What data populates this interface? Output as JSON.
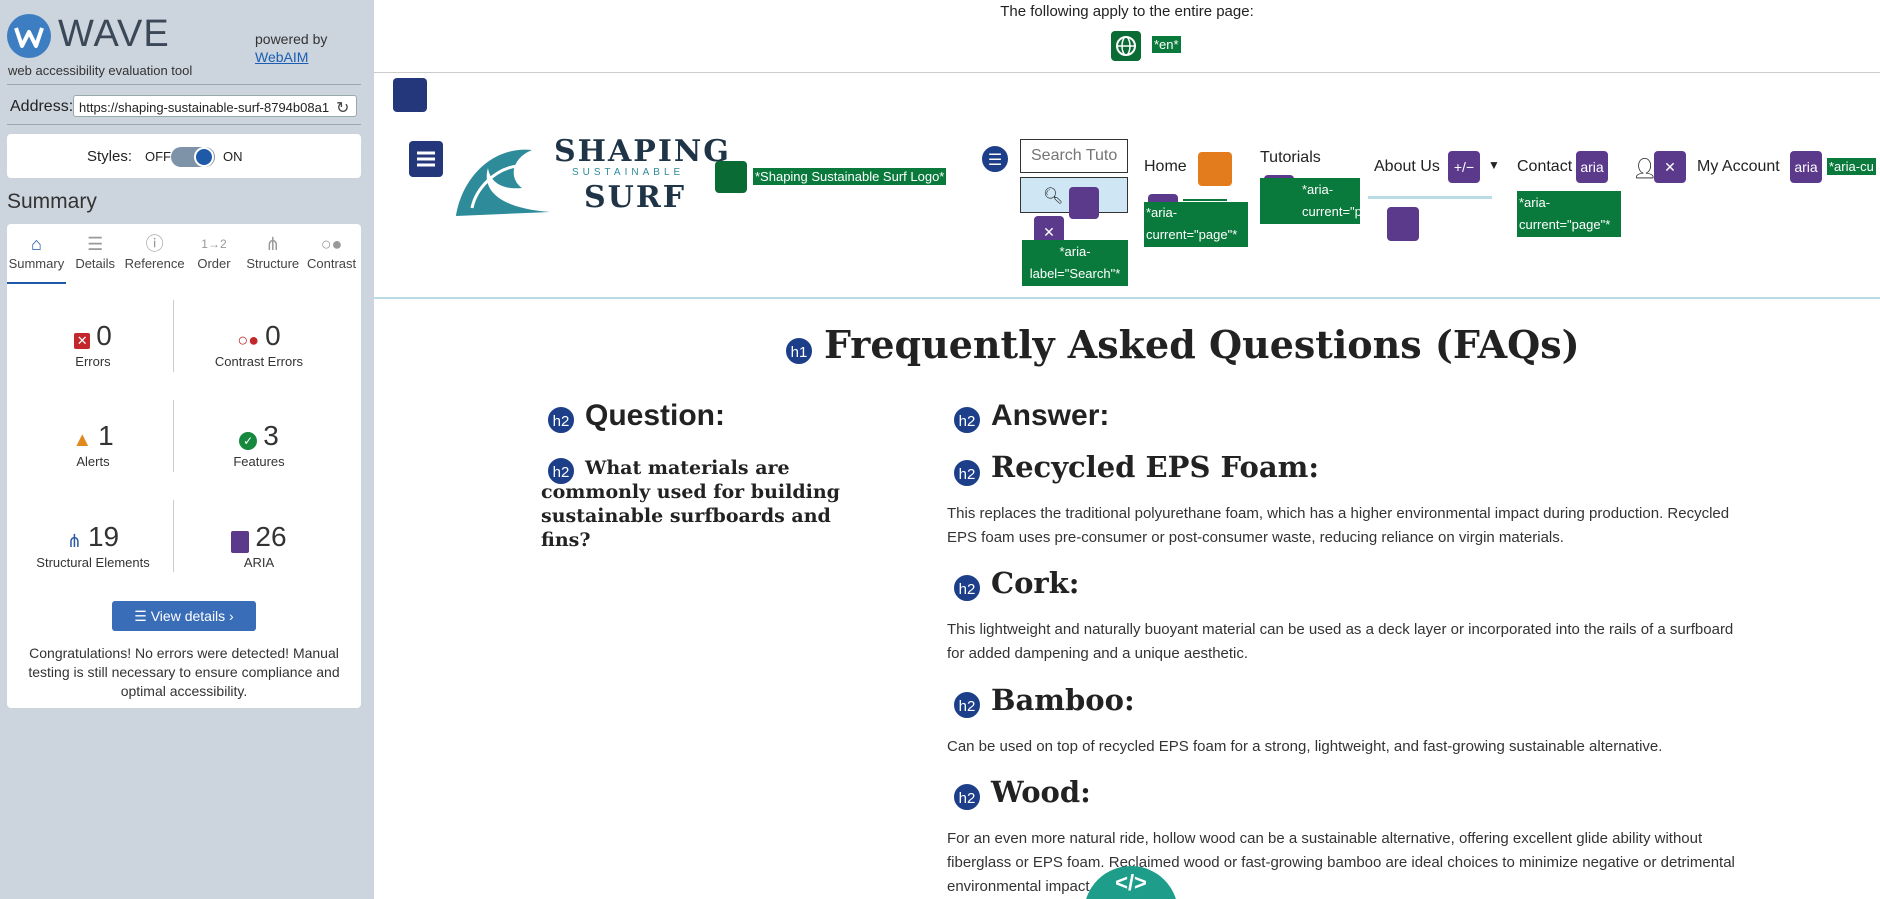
{
  "wave": {
    "logo_text": "WAVE",
    "subtitle": "web accessibility evaluation tool",
    "powered_by": "powered by",
    "webaim_link": "WebAIM",
    "address_label": "Address:",
    "address_value": "https://shaping-sustainable-surf-8794b08a1",
    "styles_label": "Styles:",
    "styles_off": "OFF",
    "styles_on": "ON",
    "summary_title": "Summary",
    "tabs": [
      {
        "label": "Summary",
        "icon": "home-icon"
      },
      {
        "label": "Details",
        "icon": "list-icon"
      },
      {
        "label": "Reference",
        "icon": "info-icon"
      },
      {
        "label": "Order",
        "icon": "order-icon"
      },
      {
        "label": "Structure",
        "icon": "structure-icon"
      },
      {
        "label": "Contrast",
        "icon": "contrast-icon"
      }
    ],
    "stats": {
      "errors": {
        "count": "0",
        "label": "Errors"
      },
      "contrast_errors": {
        "count": "0",
        "label": "Contrast Errors"
      },
      "alerts": {
        "count": "1",
        "label": "Alerts"
      },
      "features": {
        "count": "3",
        "label": "Features"
      },
      "structural": {
        "count": "19",
        "label": "Structural Elements"
      },
      "aria": {
        "count": "26",
        "label": "ARIA"
      }
    },
    "view_details": "View details ›",
    "congrats": "Congratulations! No errors were detected! Manual testing is still necessary to ensure compliance and optimal accessibility.",
    "colors": {
      "sidebar_bg": "#ccd4dd",
      "accent": "#1f5aa8",
      "feature_green": "#0b6b35",
      "aria_purple": "#5b3a8c"
    }
  },
  "page": {
    "topbar_text": "The following apply to the entire page:",
    "lang_tag": "*en*",
    "logo_alt_tag": "*Shaping Sustainable Surf Logo*",
    "brand_line1": "SHAPING",
    "brand_line2": "SUSTAINABLE",
    "brand_line3": "SURF",
    "search_placeholder": "Search Tuto",
    "aria_label_search": "*aria-label=\"Search\"*",
    "nav": {
      "home": "Home",
      "tutorials": "Tutorials",
      "about": "About Us",
      "contact": "Contact",
      "account": "My Account"
    },
    "aria_current": "*aria-current=\"page\"*",
    "aria_cut": "*aria-cu",
    "aria_badge": "aria",
    "toggle_badge": "+/−",
    "h1_badge": "h1",
    "h2_badge": "h2",
    "h1": "Frequently Asked Questions (FAQs)",
    "question_heading": "Question:",
    "question_text": "What materials are commonly used for building sustainable surfboards and fins?",
    "answer_heading": "Answer:",
    "answers": [
      {
        "heading": "Recycled EPS Foam:",
        "text": "This replaces the traditional polyurethane foam, which has a higher environmental impact during production. Recycled EPS foam uses pre-consumer or post-consumer waste, reducing reliance on virgin materials."
      },
      {
        "heading": "Cork:",
        "text": "This lightweight and naturally buoyant material can be used as a deck layer or incorporated into the rails of a surfboard for added dampening and a unique aesthetic."
      },
      {
        "heading": "Bamboo:",
        "text": "Can be used on top of recycled EPS foam for a strong, lightweight, and fast-growing sustainable alternative."
      },
      {
        "heading": "Wood:",
        "text": "For an even more natural ride, hollow wood can be a sustainable alternative, offering excellent glide ability without fiberglass or EPS foam. Reclaimed wood or fast-growing bamboo are ideal choices to minimize negative or detrimental environmental impact."
      }
    ],
    "code_toggle": "</>"
  }
}
